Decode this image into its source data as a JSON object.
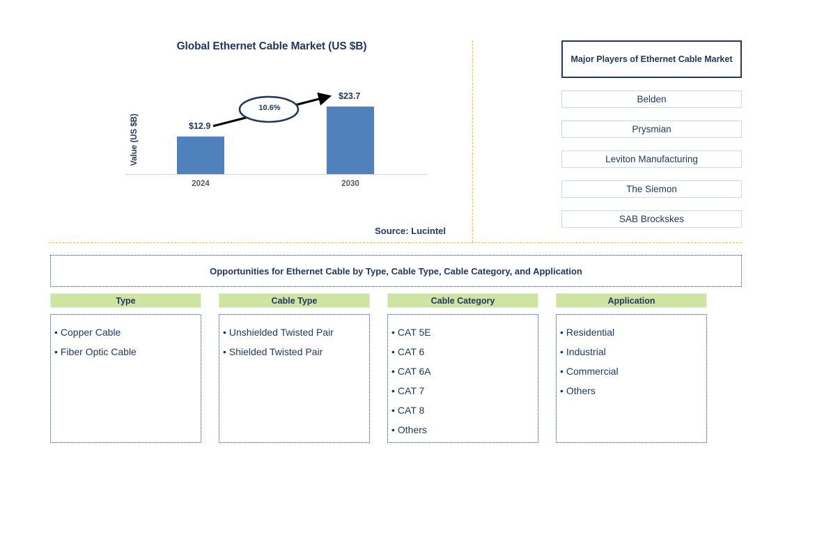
{
  "chart": {
    "title": "Global Ethernet Cable Market (US $B)",
    "y_axis_label": "Value (US $B)",
    "cagr_label": "10.6%",
    "source": "Source: Lucintel"
  },
  "chart_data": {
    "type": "bar",
    "title": "Global Ethernet Cable Market (US $B)",
    "categories": [
      "2024",
      "2030"
    ],
    "values": [
      12.9,
      23.7
    ],
    "data_labels": [
      "$12.9",
      "$23.7"
    ],
    "series": [
      {
        "name": "Value (US $B)",
        "values": [
          12.9,
          23.7
        ]
      }
    ],
    "annotations": [
      {
        "text": "10.6%",
        "type": "cagr-callout"
      }
    ],
    "xlabel": "",
    "ylabel": "Value (US $B)",
    "ylim": [
      0,
      28
    ],
    "grid": false,
    "legend": "none",
    "bar_color": "#4f81bd",
    "text_color": "#1f3864"
  },
  "players": {
    "title": "Major Players of Ethernet Cable Market",
    "items": [
      {
        "label": "Belden"
      },
      {
        "label": "Prysmian"
      },
      {
        "label": "Leviton Manufacturing"
      },
      {
        "label": "The Siemon"
      },
      {
        "label": "SAB Brockskes"
      }
    ]
  },
  "opportunities": {
    "banner": "Opportunities for Ethernet Cable by Type, Cable Type, Cable Category, and Application",
    "header_color": "#cde5a0",
    "columns": [
      {
        "header": "Type",
        "items": [
          {
            "label": "Copper Cable"
          },
          {
            "label": "Fiber Optic Cable"
          }
        ]
      },
      {
        "header": "Cable Type",
        "items": [
          {
            "label": "Unshielded Twisted Pair"
          },
          {
            "label": "Shielded Twisted Pair"
          }
        ]
      },
      {
        "header": "Cable Category",
        "items": [
          {
            "label": "CAT 5E"
          },
          {
            "label": "CAT 6"
          },
          {
            "label": "CAT 6A"
          },
          {
            "label": "CAT 7"
          },
          {
            "label": "CAT 8"
          },
          {
            "label": "Others"
          }
        ]
      },
      {
        "header": "Application",
        "items": [
          {
            "label": "Residential"
          },
          {
            "label": "Industrial"
          },
          {
            "label": "Commercial"
          },
          {
            "label": "Others"
          }
        ]
      }
    ]
  },
  "bullet_char": "•"
}
